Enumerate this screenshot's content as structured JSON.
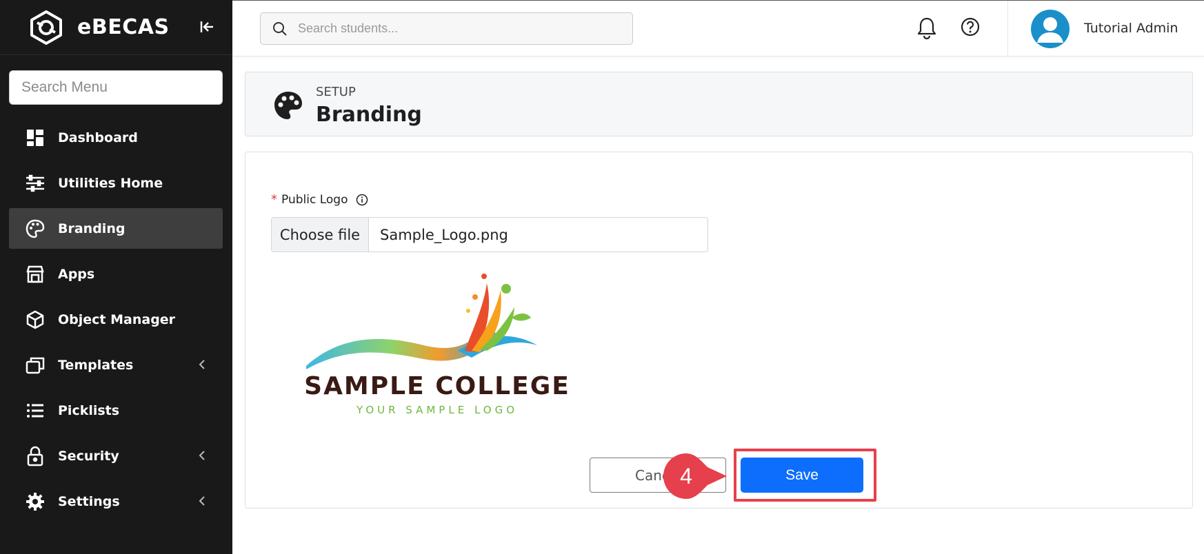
{
  "app": {
    "name": "eBECAS"
  },
  "sidebar": {
    "search_placeholder": "Search Menu",
    "items": [
      {
        "label": "Dashboard",
        "icon": "dashboard-icon"
      },
      {
        "label": "Utilities Home",
        "icon": "sliders-icon"
      },
      {
        "label": "Branding",
        "icon": "palette-icon",
        "active": true
      },
      {
        "label": "Apps",
        "icon": "store-icon"
      },
      {
        "label": "Object Manager",
        "icon": "cube-icon"
      },
      {
        "label": "Templates",
        "icon": "windows-icon",
        "has_submenu": true
      },
      {
        "label": "Picklists",
        "icon": "list-icon"
      },
      {
        "label": "Security",
        "icon": "lock-icon",
        "has_submenu": true
      },
      {
        "label": "Settings",
        "icon": "gear-icon",
        "has_submenu": true
      }
    ]
  },
  "topbar": {
    "search_placeholder": "Search students...",
    "user_name": "Tutorial Admin"
  },
  "page_header": {
    "section": "SETUP",
    "title": "Branding"
  },
  "form": {
    "field_label": "Public Logo",
    "choose_file_label": "Choose file",
    "file_name": "Sample_Logo.png",
    "logo_preview": {
      "title": "SAMPLE COLLEGE",
      "subtitle": "YOUR SAMPLE LOGO"
    },
    "cancel_label": "Cancel",
    "save_label": "Save"
  },
  "annotation": {
    "step_number": "4",
    "color": "#e6404c"
  },
  "colors": {
    "sidebar_bg": "#191919",
    "primary": "#0d6efd",
    "avatar": "#1b8fc9"
  }
}
